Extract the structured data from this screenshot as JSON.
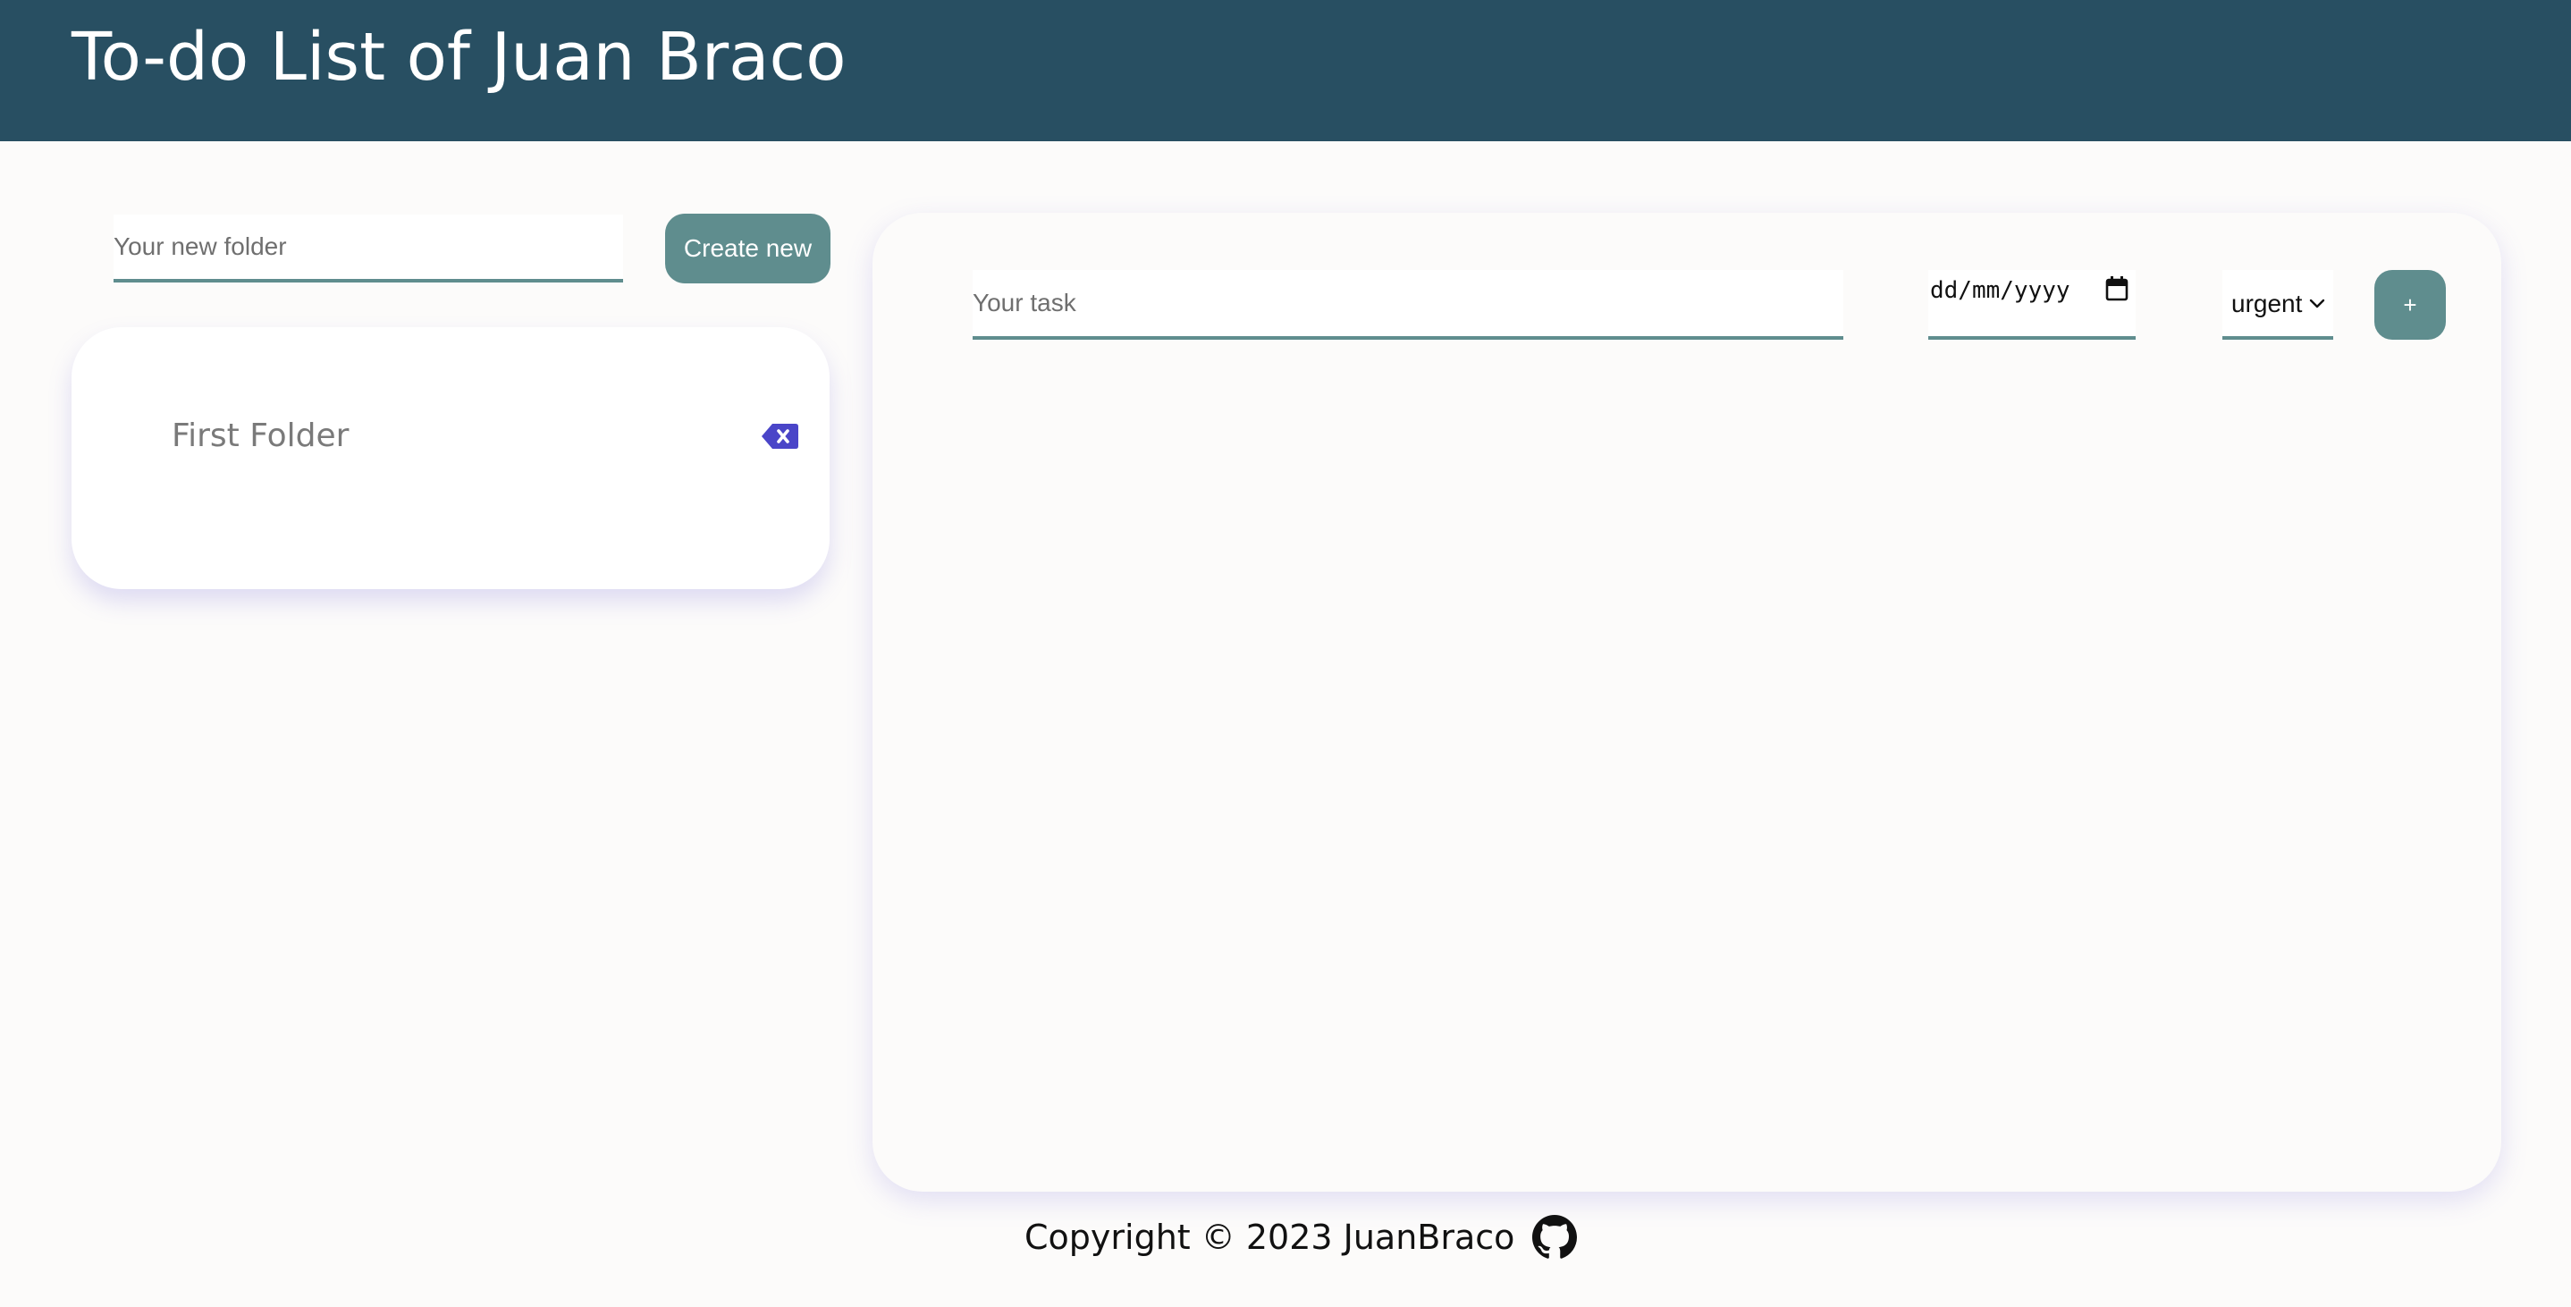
{
  "header": {
    "title": "To-do List of Juan Braco"
  },
  "folders": {
    "new_folder_placeholder": "Your new folder",
    "create_button_label": "Create new",
    "items": [
      {
        "name": "First Folder",
        "delete_icon": "backspace-x-icon"
      }
    ]
  },
  "tasks": {
    "task_placeholder": "Your task",
    "date_placeholder": "dd/mm/yyyy",
    "priority_selected": "urgent",
    "add_button_label": "+"
  },
  "footer": {
    "copyright": "Copyright © 2023 JuanBraco",
    "icon": "github-icon"
  },
  "colors": {
    "header_bg": "#284f62",
    "accent": "#5f8d8e",
    "delete_icon": "#4a45c8",
    "page_bg": "#fcfbfa"
  }
}
